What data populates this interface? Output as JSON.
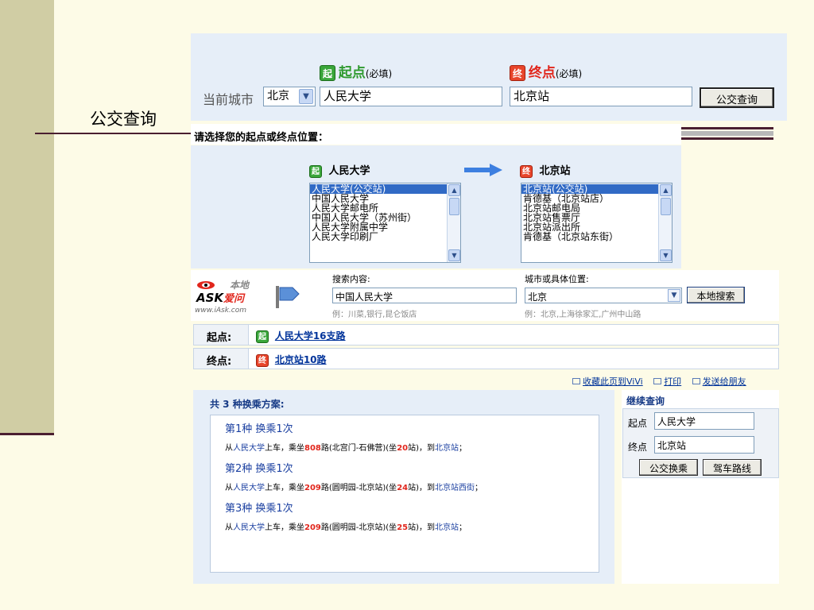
{
  "slide": {
    "title": "公交查询"
  },
  "search": {
    "city_label": "当前城市",
    "city_value": "北京",
    "start_tag": "起",
    "start_label": "起点",
    "start_note": "(必填)",
    "start_value": "人民大学",
    "end_tag": "终",
    "end_label": "终点",
    "end_note": "(必填)",
    "end_value": "北京站",
    "submit_label": "公交查询"
  },
  "select_position": {
    "header": "请选择您的起点或终点位置：",
    "start_title": "人民大学",
    "start_options": [
      "人民大学(公交站)",
      "中国人民大学",
      "人民大学邮电所",
      "中国人民大学（苏州街）",
      "人民大学附属中学",
      "人民大学印刷厂"
    ],
    "end_title": "北京站",
    "end_options": [
      "北京站(公交站)",
      "肯德基（北京站店）",
      "北京站邮电局",
      "北京站售票厅",
      "北京站派出所",
      "肯德基（北京站东街）"
    ]
  },
  "iask": {
    "logo_top": "本地",
    "logo_main": "ASK",
    "logo_cn": "爱问",
    "logo_url": "www.iAsk.com",
    "content_label": "搜索内容:",
    "content_value": "中国人民大学",
    "content_example": "例：川菜,银行,昆仑饭店",
    "location_label": "城市或具体位置:",
    "location_value": "北京",
    "location_example": "例：北京,上海徐家汇,广州中山路",
    "search_button": "本地搜索"
  },
  "route": {
    "start_label": "起点:",
    "start_link": "人民大学16支路",
    "end_label": "终点:",
    "end_link": "北京站10路"
  },
  "links": {
    "bookmark": "收藏此页到ViVi",
    "print": "打印",
    "send": "发送给朋友"
  },
  "results": {
    "summary": "共 3 种换乘方案:",
    "plans": [
      {
        "title": "第1种  换乘1次",
        "from_pre": "从",
        "from": "人民大学",
        "mid1": "上车，乘坐",
        "bus": "808",
        "mid2": "路(北宫门-石佛营)(坐",
        "stops": "20",
        "mid3": "站)，到",
        "to": "北京站",
        "end": "；"
      },
      {
        "title": "第2种  换乘1次",
        "from_pre": "从",
        "from": "人民大学",
        "mid1": "上车，乘坐",
        "bus": "209",
        "mid2": "路(圆明园-北京站)(坐",
        "stops": "24",
        "mid3": "站)，到",
        "to": "北京站西街",
        "end": "；"
      },
      {
        "title": "第3种  换乘1次",
        "from_pre": "从",
        "from": "人民大学",
        "mid1": "上车，乘坐",
        "bus": "209",
        "mid2": "路(圆明园-北京站)(坐",
        "stops": "25",
        "mid3": "站)，到",
        "to": "北京站",
        "end": "；"
      }
    ]
  },
  "continue": {
    "title": "继续查询",
    "start_label": "起点",
    "start_value": "人民大学",
    "end_label": "终点",
    "end_value": "北京站",
    "transit_button": "公交换乘",
    "drive_button": "驾车路线"
  }
}
